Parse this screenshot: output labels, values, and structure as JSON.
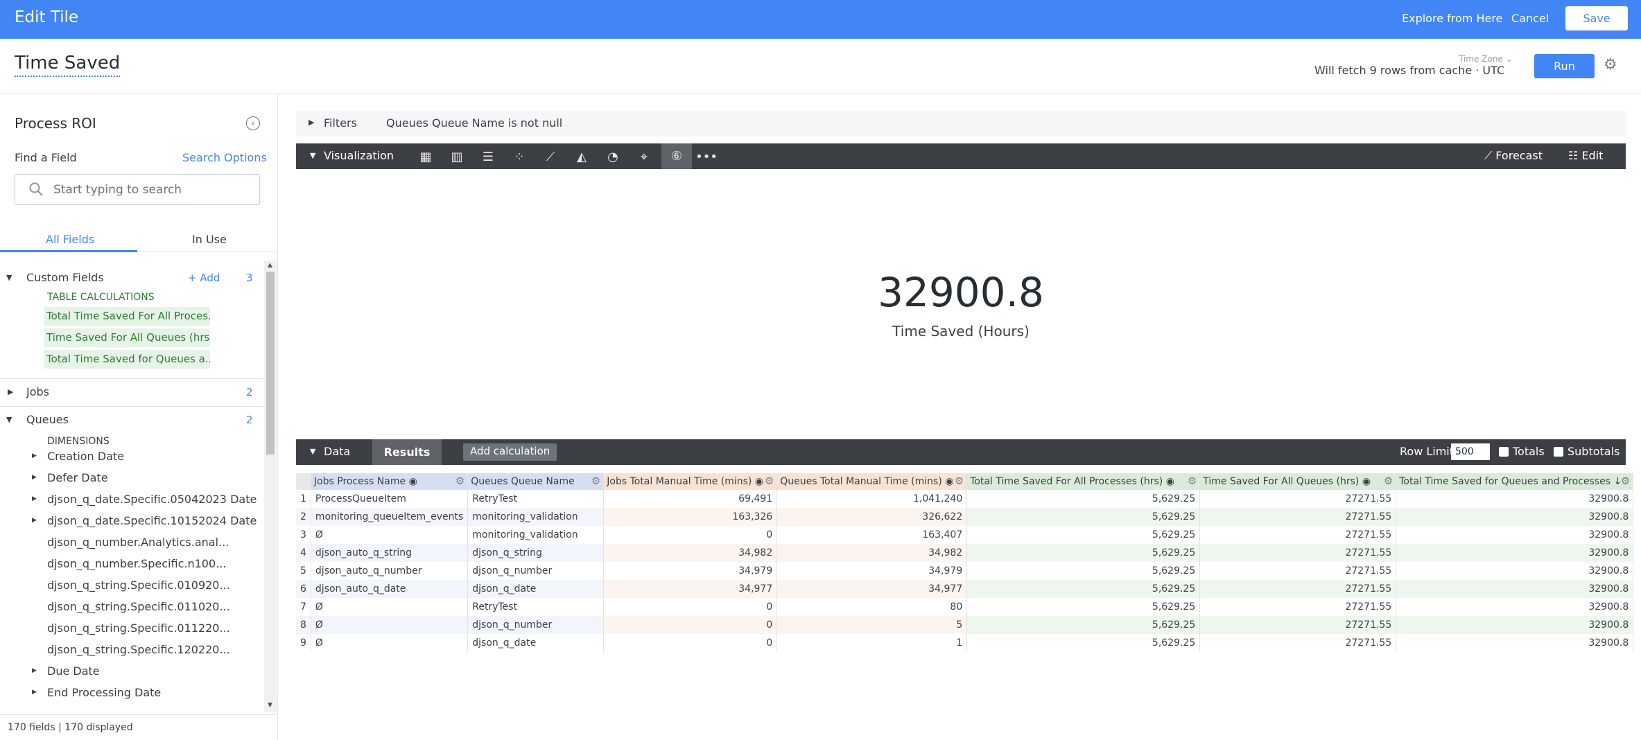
{
  "topbar": {
    "title": "Edit Tile",
    "explore_label": "Explore from Here",
    "cancel_label": "Cancel",
    "save_label": "Save",
    "background_color": "#4285f4"
  },
  "tile": {
    "title": "Time Saved",
    "timezone_label": "Time Zone",
    "fetch_status": "Will fetch 9 rows from cache · UTC",
    "run_label": "Run"
  },
  "sidebar": {
    "title": "Process ROI",
    "find_label": "Find a Field",
    "search_options_label": "Search Options",
    "search_placeholder": "Start typing to search",
    "tabs": [
      {
        "label": "All Fields",
        "active": true
      },
      {
        "label": "In Use",
        "active": false
      }
    ],
    "custom_fields": {
      "label": "Custom Fields",
      "add_label": "+ Add",
      "count": "3",
      "section_label": "TABLE CALCULATIONS",
      "items": [
        "Total Time Saved For All Proces...",
        "Time Saved For All Queues (hrs)",
        "Total Time Saved for Queues a..."
      ]
    },
    "groups": [
      {
        "label": "Jobs",
        "count": "2"
      },
      {
        "label": "Queues",
        "count": "2"
      }
    ],
    "dimensions_label": "DIMENSIONS",
    "dimension_items": [
      {
        "label": "Creation Date",
        "expandable": true
      },
      {
        "label": "Defer Date",
        "expandable": true
      },
      {
        "label": "djson_q_date.Specific.05042023 Date",
        "expandable": true
      },
      {
        "label": "djson_q_date.Specific.10152024 Date",
        "expandable": true
      },
      {
        "label": "djson_q_number.Analytics.anal...",
        "expandable": false
      },
      {
        "label": "djson_q_number.Specific.n100...",
        "expandable": false
      },
      {
        "label": "djson_q_string.Specific.010920...",
        "expandable": false
      },
      {
        "label": "djson_q_string.Specific.011020...",
        "expandable": false
      },
      {
        "label": "djson_q_string.Specific.011220...",
        "expandable": false
      },
      {
        "label": "djson_q_string.Specific.120220...",
        "expandable": false
      },
      {
        "label": "Due Date",
        "expandable": true
      },
      {
        "label": "End Processing Date",
        "expandable": true
      }
    ],
    "footer": "170 fields | 170 displayed"
  },
  "filters": {
    "label": "Filters",
    "value": "Queues Queue Name is not null"
  },
  "visualization": {
    "label": "Visualization",
    "icons": [
      "table-icon",
      "bar-chart-icon",
      "horizontal-bar-icon",
      "scatter-icon",
      "line-chart-icon",
      "area-chart-icon",
      "pie-chart-icon",
      "map-pin-icon",
      "single-value-icon",
      "more-icon"
    ],
    "selected_icon": "single-value-icon",
    "forecast_label": "Forecast",
    "edit_label": "Edit"
  },
  "single_value": {
    "value": "32900.8",
    "label": "Time Saved (Hours)"
  },
  "data_panel": {
    "data_label": "Data",
    "results_label": "Results",
    "add_calculation_label": "Add calculation",
    "row_limit_label": "Row Limit",
    "row_limit_value": "500",
    "totals_label": "Totals",
    "subtotals_label": "Subtotals"
  },
  "table": {
    "columns": [
      {
        "label": "Jobs Process Name",
        "kind": "dim"
      },
      {
        "label": "Queues Queue Name",
        "kind": "dim"
      },
      {
        "label": "Jobs Total Manual Time (mins)",
        "kind": "meas"
      },
      {
        "label": "Queues Total Manual Time (mins)",
        "kind": "meas"
      },
      {
        "label": "Total Time Saved For All Processes (hrs)",
        "kind": "calc"
      },
      {
        "label": "Time Saved For All Queues (hrs)",
        "kind": "calc"
      },
      {
        "label": "Total Time Saved for Queues and Processes ↓",
        "kind": "calc"
      }
    ],
    "rows": [
      [
        "1",
        "ProcessQueueItem",
        "RetryTest",
        "69,491",
        "1,041,240",
        "5,629.25",
        "27271.55",
        "32900.8"
      ],
      [
        "2",
        "monitoring_queueItem_events",
        "monitoring_validation",
        "163,326",
        "326,622",
        "5,629.25",
        "27271.55",
        "32900.8"
      ],
      [
        "3",
        "Ø",
        "monitoring_validation",
        "0",
        "163,407",
        "5,629.25",
        "27271.55",
        "32900.8"
      ],
      [
        "4",
        "djson_auto_q_string",
        "djson_q_string",
        "34,982",
        "34,982",
        "5,629.25",
        "27271.55",
        "32900.8"
      ],
      [
        "5",
        "djson_auto_q_number",
        "djson_q_number",
        "34,979",
        "34,979",
        "5,629.25",
        "27271.55",
        "32900.8"
      ],
      [
        "6",
        "djson_auto_q_date",
        "djson_q_date",
        "34,977",
        "34,977",
        "5,629.25",
        "27271.55",
        "32900.8"
      ],
      [
        "7",
        "Ø",
        "RetryTest",
        "0",
        "80",
        "5,629.25",
        "27271.55",
        "32900.8"
      ],
      [
        "8",
        "Ø",
        "djson_q_number",
        "0",
        "5",
        "5,629.25",
        "27271.55",
        "32900.8"
      ],
      [
        "9",
        "Ø",
        "djson_q_date",
        "0",
        "1",
        "5,629.25",
        "27271.55",
        "32900.8"
      ]
    ]
  }
}
